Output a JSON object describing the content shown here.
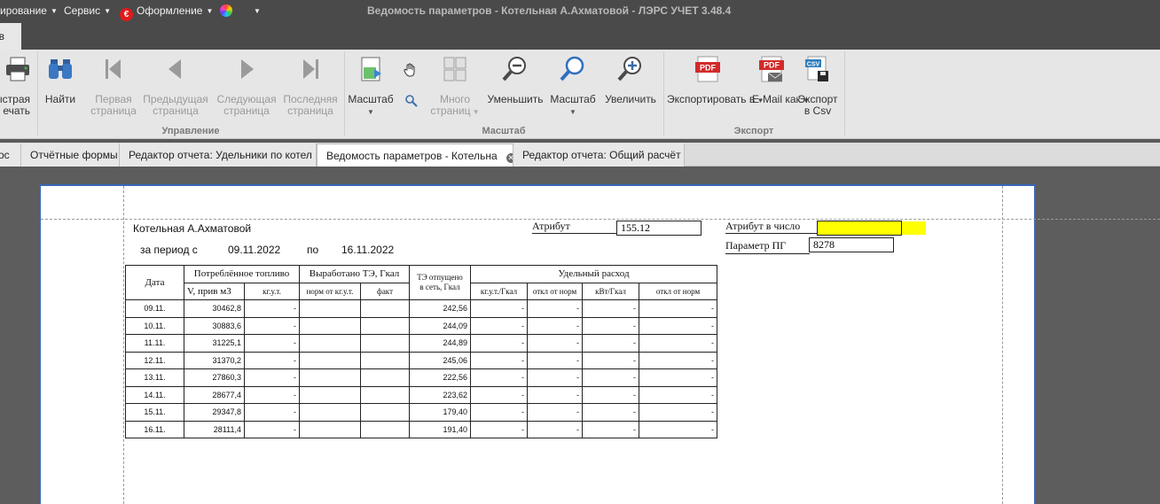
{
  "window": {
    "title": "Ведомость параметров - Котельная А.Ахматовой - ЛЭРС УЧЕТ 3.48.4",
    "menu": [
      "ирование",
      "Сервис",
      "Оформление"
    ]
  },
  "ribbon_tab": "ов",
  "ribbon": {
    "buttons": {
      "quick_print": "ыстрая\nечать",
      "find": "Найти",
      "first_page": "Первая\nстраница",
      "prev_page": "Предыдущая\nстраница",
      "next_page": "Следующая\nстраница",
      "last_page": "Последняя\nстраница",
      "scale": "Масштаб",
      "many_pages": "Много\nстраниц",
      "zoom_out": "Уменьшить",
      "zoom": "Масштаб",
      "zoom_in": "Увеличить",
      "export_to": "Экспортировать\nв",
      "email_as": "E-Mail\nкак",
      "export_csv": "Экспорт\nв Csv"
    },
    "groups": {
      "control": "Управление",
      "scale": "Масштаб",
      "export": "Экспорт"
    }
  },
  "doc_tabs": [
    "ос",
    "Отчётные формы",
    "Редактор отчета: Удельники по котел",
    "Ведомость параметров - Котельна",
    "Редактор отчета: Общий расчёт"
  ],
  "report": {
    "boiler_name": "Котельная А.Ахматовой",
    "period_label": "за период с",
    "date_from": "09.11.2022",
    "to_label": "по",
    "date_to": "16.11.2022",
    "attr_label": "Атрибут",
    "attr_value": "155.12",
    "attr_num_label": "Атрибут в число",
    "attr_num_value": "",
    "param_pg_label": "Параметр ПГ",
    "param_pg_value": "8278",
    "headers": {
      "date": "Дата",
      "fuel": "Потреблённое топливо",
      "produced": "Выработано ТЭ, Гкал",
      "released": "ТЭ отпущено\nв сеть, Гкал",
      "specific": "Удельный расход",
      "v_priv": "V, прив м3",
      "kg_ut": "кг.у.т.",
      "norm_kg": "норм от кг.у.т.",
      "fact": "факт",
      "kg_gcal": "кг.у.т./Гкал",
      "otkl_norm": "откл от норм",
      "kwt_gcal": "кВт/Гкал",
      "otkl_norm2": "откл от норм"
    },
    "rows": [
      {
        "date": "09.11.",
        "v": "30462,8",
        "kg": "-",
        "norm": "",
        "fact": "",
        "te": "242,56",
        "sp1": "-",
        "sp2": "-",
        "sp3": "-",
        "sp4": "-"
      },
      {
        "date": "10.11.",
        "v": "30883,6",
        "kg": "-",
        "norm": "",
        "fact": "",
        "te": "244,09",
        "sp1": "-",
        "sp2": "-",
        "sp3": "-",
        "sp4": "-"
      },
      {
        "date": "11.11.",
        "v": "31225,1",
        "kg": "-",
        "norm": "",
        "fact": "",
        "te": "244,89",
        "sp1": "-",
        "sp2": "-",
        "sp3": "-",
        "sp4": "-"
      },
      {
        "date": "12.11.",
        "v": "31370,2",
        "kg": "-",
        "norm": "",
        "fact": "",
        "te": "245,06",
        "sp1": "-",
        "sp2": "-",
        "sp3": "-",
        "sp4": "-"
      },
      {
        "date": "13.11.",
        "v": "27860,3",
        "kg": "-",
        "norm": "",
        "fact": "",
        "te": "222,56",
        "sp1": "-",
        "sp2": "-",
        "sp3": "-",
        "sp4": "-"
      },
      {
        "date": "14.11.",
        "v": "28677,4",
        "kg": "-",
        "norm": "",
        "fact": "",
        "te": "223,62",
        "sp1": "-",
        "sp2": "-",
        "sp3": "-",
        "sp4": "-"
      },
      {
        "date": "15.11.",
        "v": "29347,8",
        "kg": "-",
        "norm": "",
        "fact": "",
        "te": "179,40",
        "sp1": "-",
        "sp2": "-",
        "sp3": "-",
        "sp4": "-"
      },
      {
        "date": "16.11.",
        "v": "28111,4",
        "kg": "-",
        "norm": "",
        "fact": "",
        "te": "191,40",
        "sp1": "-",
        "sp2": "-",
        "sp3": "-",
        "sp4": "-"
      }
    ]
  },
  "colors": {
    "title_bg": "#4a4a4a",
    "ribbon_bg": "#e6e6e6",
    "accent_blue": "#2f6fbf",
    "pdf_red": "#d32a2a",
    "highlight_yellow": "#ffff00"
  },
  "icons": {
    "print": "printer-icon",
    "find": "binoculars-icon",
    "first": "first-page-icon",
    "prev": "prev-page-icon",
    "next": "next-page-icon",
    "last": "last-page-icon",
    "scale": "scale-page-icon",
    "hand": "hand-icon",
    "magnifier": "magnifier-icon",
    "many_pages": "many-pages-icon",
    "zoom_out": "zoom-out-icon",
    "zoom": "zoom-icon",
    "zoom_in": "zoom-in-icon",
    "pdf": "pdf-icon",
    "email_pdf": "email-pdf-icon",
    "csv": "csv-icon"
  }
}
